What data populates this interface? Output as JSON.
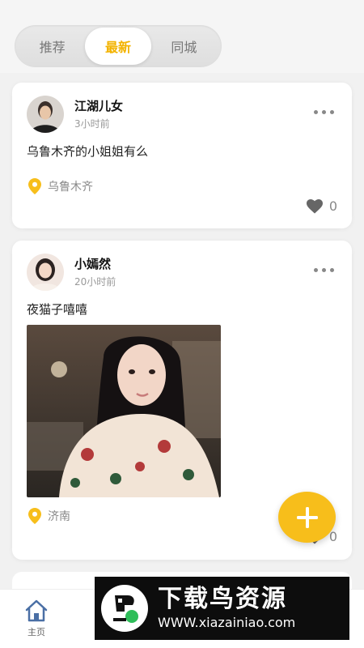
{
  "tabs": [
    {
      "label": "推荐",
      "active": false
    },
    {
      "label": "最新",
      "active": true
    },
    {
      "label": "同城",
      "active": false
    }
  ],
  "posts": [
    {
      "username": "江湖儿女",
      "time": "3小时前",
      "text": "乌鲁木齐的小姐姐有么",
      "location": "乌鲁木齐",
      "likes": "0",
      "icons": [
        "avatar",
        "more-icon",
        "location-pin-icon",
        "heart-icon"
      ]
    },
    {
      "username": "小嫣然",
      "time": "20小时前",
      "text": "夜猫子嘻嘻",
      "location": "济南",
      "likes": "0",
      "icons": [
        "avatar",
        "more-icon",
        "photo",
        "location-pin-icon",
        "heart-icon"
      ]
    }
  ],
  "fab": {
    "icon": "plus-icon"
  },
  "bottom_nav": {
    "items": [
      {
        "label": "主页",
        "icon": "home-icon"
      }
    ]
  },
  "watermark": {
    "title": "下载鸟资源",
    "url": "WWW.xiazainiao.com"
  },
  "colors": {
    "accent": "#f7be1b",
    "active_tab_text": "#f3b300",
    "background": "#f1f1f1"
  }
}
